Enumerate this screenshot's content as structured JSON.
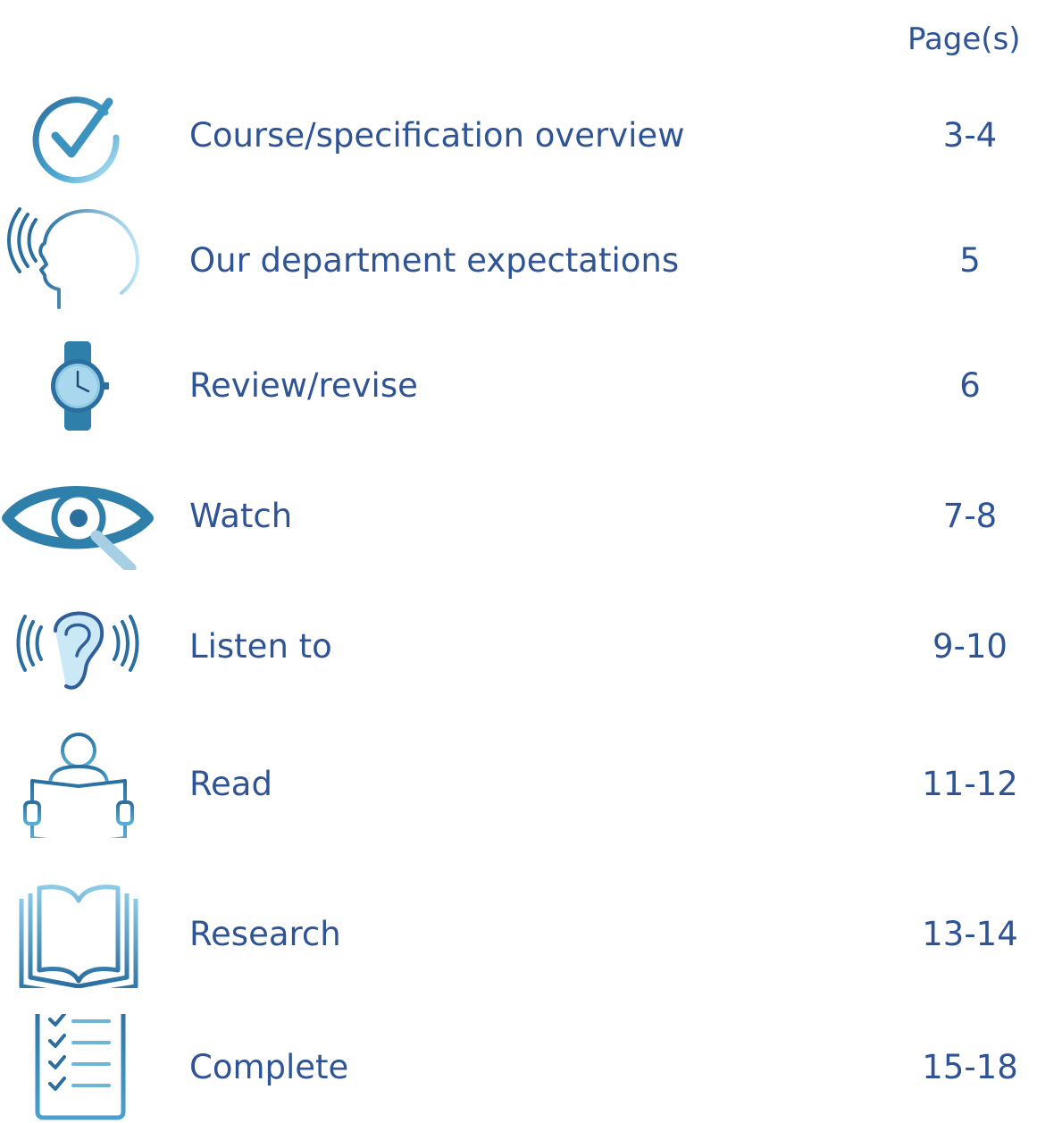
{
  "header": {
    "pages_label": "Page(s)"
  },
  "items": [
    {
      "label": "Course/specification overview",
      "pages": "3-4",
      "icon": "checkmark-circle-icon"
    },
    {
      "label": "Our department expectations",
      "pages": "5",
      "icon": "speaking-head-icon"
    },
    {
      "label": "Review/revise",
      "pages": "6",
      "icon": "wristwatch-icon"
    },
    {
      "label": "Watch",
      "pages": "7-8",
      "icon": "eye-magnifier-icon"
    },
    {
      "label": "Listen to",
      "pages": "9-10",
      "icon": "ear-sound-icon"
    },
    {
      "label": "Read",
      "pages": "11-12",
      "icon": "person-reading-icon"
    },
    {
      "label": "Research",
      "pages": "13-14",
      "icon": "open-book-icon"
    },
    {
      "label": "Complete",
      "pages": "15-18",
      "icon": "clipboard-checklist-icon"
    }
  ],
  "colors": {
    "text": "#2f5496",
    "icon_dark": "#2a6fa0",
    "icon_mid": "#3d93c0",
    "icon_light": "#aedcf2"
  }
}
